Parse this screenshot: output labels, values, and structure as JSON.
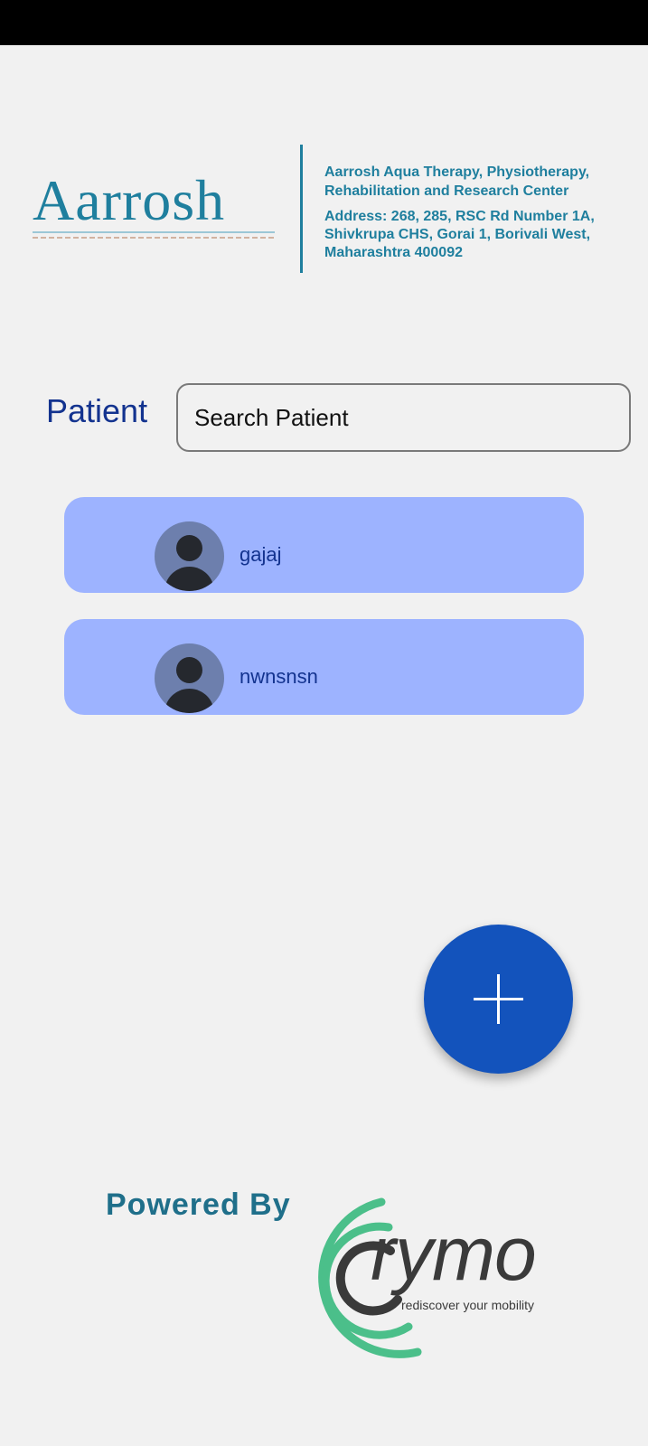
{
  "header": {
    "logo_text": "Aarrosh",
    "center_name": "Aarrosh Aqua Therapy, Physiotherapy, Rehabilitation and Research Center",
    "address": "Address: 268, 285, RSC Rd Number 1A, Shivkrupa CHS, Gorai 1, Borivali West, Maharashtra 400092",
    "accent_color": "#1f7f9e"
  },
  "search": {
    "label": "Patient",
    "placeholder": "Search Patient"
  },
  "patients": [
    {
      "name": "gajaj",
      "avatar_icon": "person-avatar-icon"
    },
    {
      "name": "nwnsnsn",
      "avatar_icon": "person-avatar-icon"
    }
  ],
  "fab": {
    "icon": "plus-icon",
    "color": "#1353bc"
  },
  "footer": {
    "powered_by": "Powered By",
    "brand_name": "rymo",
    "brand_tagline": "rediscover your mobility",
    "brand_color": "#4bbf8a"
  },
  "colors": {
    "card_background": "#9db3ff",
    "label_color": "#13338f",
    "background": "#f1f1f1"
  }
}
